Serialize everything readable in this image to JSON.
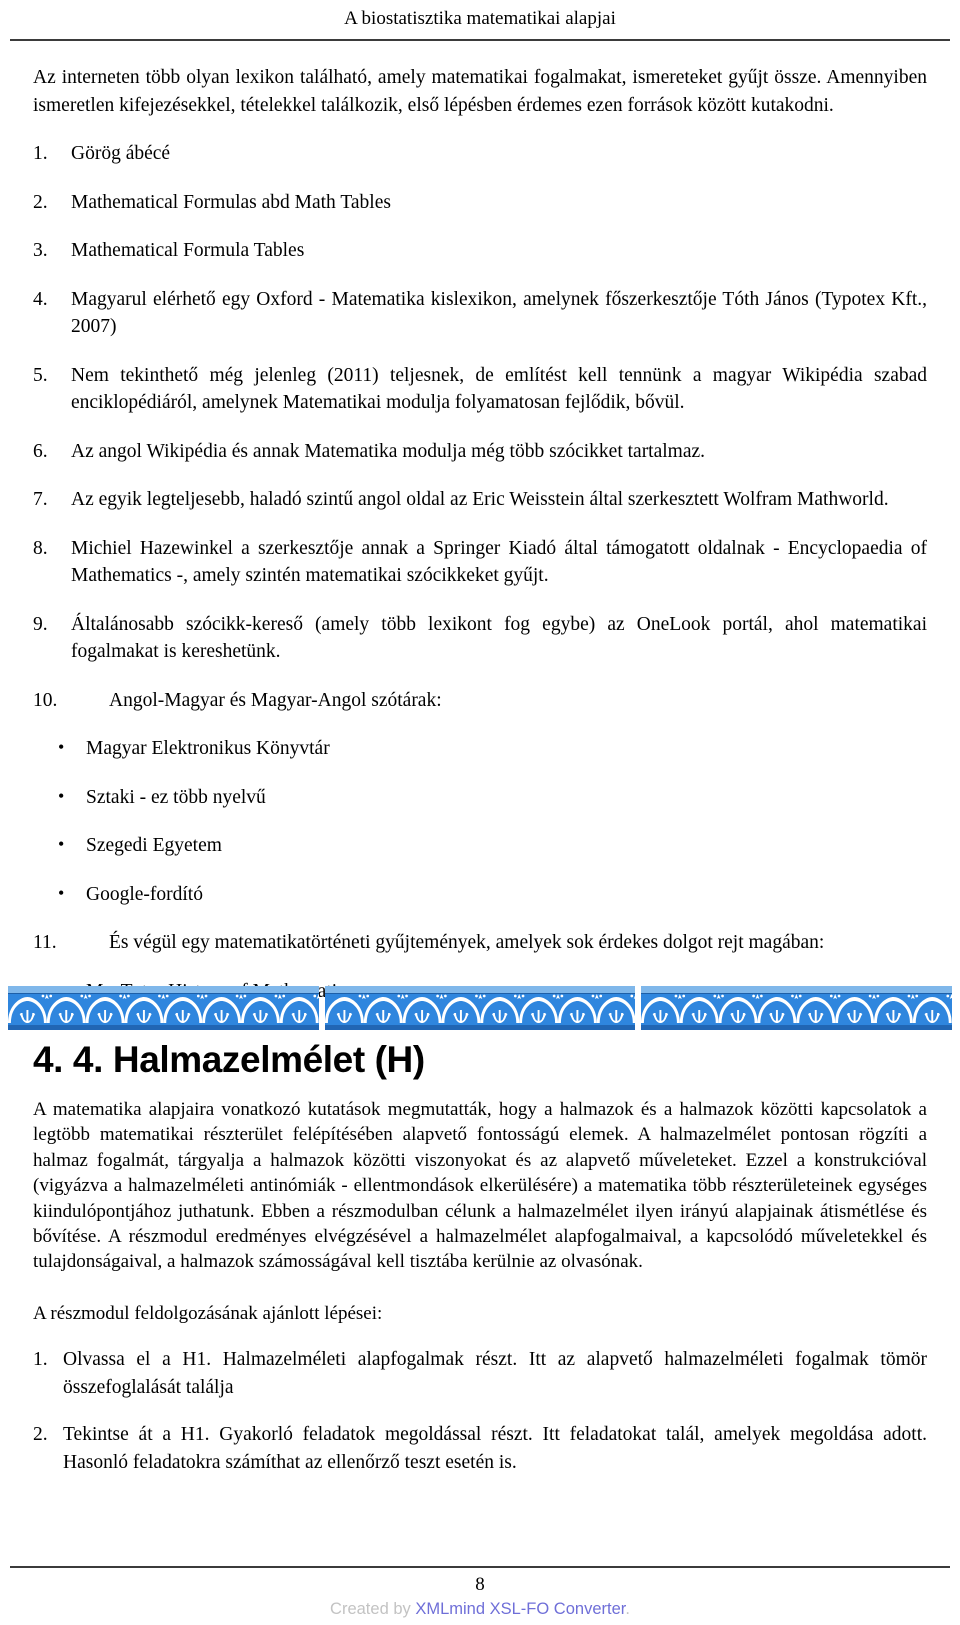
{
  "header": {
    "running_title": "A biostatisztika matematikai alapjai"
  },
  "intro": {
    "paragraph": "Az interneten több olyan lexikon található, amely matematikai fogalmakat, ismereteket gyűjt össze. Amennyiben ismeretlen kifejezésekkel, tételekkel találkozik, első lépésben érdemes ezen források között kutakodni."
  },
  "resource_list": [
    {
      "marker": "1.",
      "text": "Görög ábécé"
    },
    {
      "marker": "2.",
      "text": "Mathematical Formulas abd Math Tables"
    },
    {
      "marker": "3.",
      "text": "Mathematical Formula Tables"
    },
    {
      "marker": "4.",
      "text": "Magyarul elérhető egy Oxford - Matematika kislexikon, amelynek főszerkesztője Tóth János (Typotex Kft., 2007)"
    },
    {
      "marker": "5.",
      "text": "Nem tekinthető még jelenleg (2011) teljesnek, de említést kell tennünk a magyar Wikipédia szabad enciklopédiáról, amelynek Matematikai modulja folyamatosan fejlődik, bővül."
    },
    {
      "marker": "6.",
      "text": "Az angol Wikipédia és annak Matematika modulja még több szócikket tartalmaz."
    },
    {
      "marker": "7.",
      "text": "Az egyik legteljesebb, haladó szintű angol oldal az Eric Weisstein által szerkesztett Wolfram Mathworld."
    },
    {
      "marker": "8.",
      "text": "Michiel Hazewinkel a szerkesztője annak a Springer Kiadó által támogatott oldalnak - Encyclopaedia of Mathematics -, amely szintén matematikai szócikkeket gyűjt."
    },
    {
      "marker": "9.",
      "text": "Általánosabb szócikk-kereső (amely több lexikont fog egybe) az OneLook portál, ahol matematikai fogalmakat is kereshetünk."
    }
  ],
  "item_ten": {
    "marker": "10.",
    "text": "Angol-Magyar és Magyar-Angol szótárak:",
    "bullets": [
      "Magyar Elektronikus Könyvtár",
      "Sztaki - ez több nyelvű",
      "Szegedi Egyetem",
      "Google-fordító"
    ]
  },
  "item_eleven": {
    "marker": "11.",
    "text": "És végül egy matematikatörténeti gyűjtemények, amelyek sok érdekes dolgot rejt magában:",
    "bullets": [
      "MacTutor History of Mathematics"
    ]
  },
  "bullet_glyph": "•",
  "decorative_banner": {
    "name": "greek-palmette-border",
    "segments": 3,
    "colors": {
      "field": "#2f86de",
      "top_band": "#7fb7ea",
      "bottom_band": "#2166b4",
      "motif": "#ffffff"
    }
  },
  "section": {
    "title": "4. 4. Halmazelmélet (H)",
    "paragraph": "A matematika alapjaira vonatkozó kutatások megmutatták, hogy a halmazok és a halmazok közötti kapcsolatok a legtöbb matematikai részterület felépítésében alapvető fontosságú elemek. A halmazelmélet pontosan rögzíti a halmaz fogalmát, tárgyalja a halmazok közötti viszonyokat és az alapvető műveleteket. Ezzel a konstrukcióval (vigyázva a halmazelméleti antinómiák - ellentmondások elkerülésére) a matematika több részterületeinek egységes kiindulópontjához juthatunk. Ebben a részmodulban célunk a halmazelmélet ilyen irányú alapjainak átismétlése és bővítése. A részmodul eredményes elvégzésével a halmazelmélet alapfogalmaival, a kapcsolódó műveletekkel és tulajdonságaival, a halmazok számosságával kell tisztába kerülnie az olvasónak.",
    "steps_intro": "A részmodul feldolgozásának ajánlott lépései:",
    "steps": [
      {
        "marker": "1.",
        "text": "Olvassa el a H1. Halmazelméleti alapfogalmak részt. Itt az alapvető halmazelméleti fogalmak tömör összefoglalását találja"
      },
      {
        "marker": "2.",
        "text": "Tekintse át a H1. Gyakorló feladatok megoldással részt. Itt feladatokat talál, amelyek megoldása adott. Hasonló feladatokra számíthat az ellenőrző teszt esetén is."
      }
    ]
  },
  "footer": {
    "page_number": "8",
    "attribution_prefix": "Created by ",
    "attribution_brand": "XMLmind XSL-FO Converter",
    "attribution_period": ".",
    "brand_color": "#6f6fd8",
    "prefix_color": "#c3c3c3"
  }
}
